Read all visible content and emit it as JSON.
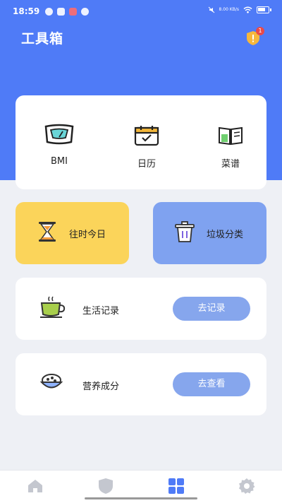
{
  "status_bar": {
    "time": "18:59",
    "network": "8.00 KB/s"
  },
  "header": {
    "title": "工具箱",
    "notification_count": "1"
  },
  "tools": [
    {
      "label": "BMI",
      "icon": "scale-icon"
    },
    {
      "label": "日历",
      "icon": "calendar-icon"
    },
    {
      "label": "菜谱",
      "icon": "recipe-book-icon"
    }
  ],
  "shortcuts": {
    "history_today": {
      "label": "往时今日",
      "icon": "hourglass-icon"
    },
    "garbage": {
      "label": "垃圾分类",
      "icon": "trash-icon"
    }
  },
  "life_record": {
    "label": "生活记录",
    "button": "去记录",
    "icon": "tea-cup-icon"
  },
  "nutrition": {
    "label": "营养成分",
    "button": "去查看",
    "icon": "food-bowl-icon"
  },
  "tabbar": {
    "tabs": [
      {
        "name": "home",
        "icon": "home-icon",
        "active": false
      },
      {
        "name": "shield",
        "icon": "shield-icon",
        "active": false
      },
      {
        "name": "tools",
        "icon": "grid-icon",
        "active": true
      },
      {
        "name": "settings",
        "icon": "gear-icon",
        "active": false
      }
    ]
  },
  "colors": {
    "primary": "#4f7bf7",
    "yellow_card": "#fbd45a",
    "blue_card": "#7fa2f0",
    "pill": "#86a6ed",
    "background": "#eef0f5"
  }
}
